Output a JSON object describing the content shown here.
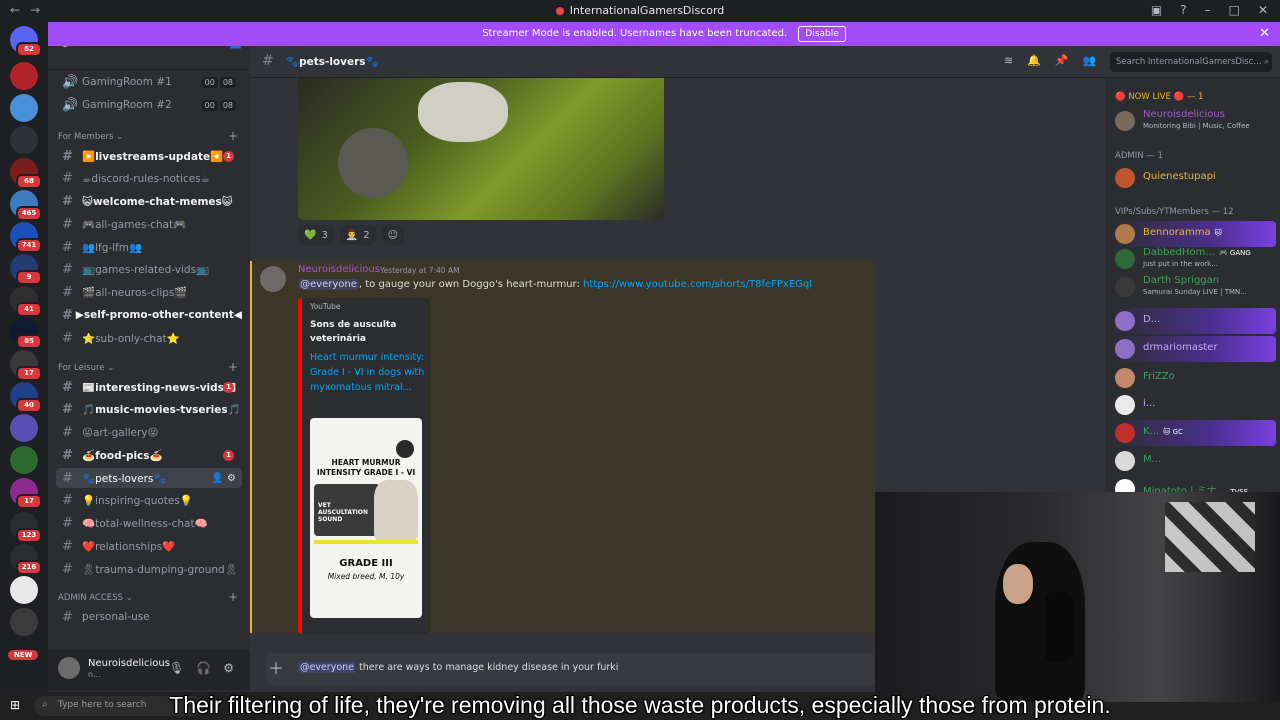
{
  "window": {
    "title": "InternationalGamersDiscord"
  },
  "streamer_banner": {
    "text": "Streamer Mode is enabled. Usernames have been truncated.",
    "button": "Disable"
  },
  "guild": {
    "name": "InternationalGamersDisc..."
  },
  "rail": {
    "badges": [
      "62",
      "68",
      "465",
      "741",
      "9",
      "41",
      "85",
      "17",
      "40",
      "17",
      "123",
      "216"
    ],
    "new_label": "NEW"
  },
  "channels": {
    "voice": [
      {
        "name": "GamingRoom #1",
        "a": "00",
        "b": "08"
      },
      {
        "name": "GamingRoom #2",
        "a": "00",
        "b": "08"
      }
    ],
    "cat_members": "For Members",
    "members_channels": [
      {
        "name": "▶️livestreams-update◀️",
        "unread": true,
        "badge": "1"
      },
      {
        "name": "☕discord-rules-notices☕",
        "unread": false
      },
      {
        "name": "😺welcome-chat-memes😺",
        "unread": true
      },
      {
        "name": "🎮all-games-chat🎮",
        "unread": false
      },
      {
        "name": "👥lfg-lfm👥",
        "unread": false
      },
      {
        "name": "📺games-related-vids📺",
        "unread": false
      },
      {
        "name": "🎬all-neuros-clips🎬",
        "unread": false
      },
      {
        "name": "▶self-promo-other-content◀",
        "unread": true
      },
      {
        "name": "⭐sub-only-chat⭐",
        "unread": false
      }
    ],
    "cat_leisure": "For Leisure",
    "leisure_channels": [
      {
        "name": "📰interesting-news-vids📰",
        "unread": true,
        "badge": "1"
      },
      {
        "name": "🎵music-movies-tvseries🎵",
        "unread": true
      },
      {
        "name": "😝art-gallery😝",
        "unread": false
      },
      {
        "name": "🍝food-pics🍝",
        "unread": true,
        "badge": "1"
      },
      {
        "name": "🐾pets-lovers🐾",
        "selected": true
      },
      {
        "name": "💡inspiring-quotes💡",
        "unread": false
      },
      {
        "name": "🧠total-wellness-chat🧠",
        "unread": false
      },
      {
        "name": "❤️relationships❤️",
        "unread": false
      },
      {
        "name": "🎗trauma-dumping-ground🎗",
        "unread": false
      }
    ],
    "cat_admin": "ADMIN ACCESS",
    "admin_channels": [
      {
        "name": "personal-use"
      }
    ]
  },
  "user": {
    "name": "Neuroisdelicious",
    "sub": "n..."
  },
  "header": {
    "channel": "🐾pets-lovers🐾",
    "search_placeholder": "Search InternationalGamersDisc..."
  },
  "chat": {
    "reactions": [
      {
        "emoji": "💚",
        "count": "3"
      },
      {
        "emoji": "👨‍⚕️",
        "count": "2"
      }
    ],
    "message": {
      "author": "Neuroisdelicious",
      "timestamp": "Yesterday at 7:40 AM",
      "mention": "@everyone",
      "text": ", to gauge your own Doggo's heart-murmur: ",
      "link": "https://www.youtube.com/shorts/T8feFPxEGqI"
    },
    "embed": {
      "provider": "YouTube",
      "author": "Sons de ausculta veterinária",
      "title": "Heart murmur intensity: Grade I - VI in dogs with myxomatous mitral...",
      "thumb_heading": "HEART MURMUR INTENSITY GRADE I - VI",
      "thumb_box": "VET AUSCULTATION SOUND",
      "thumb_grade": "GRADE III",
      "thumb_sub": "Mixed breed, M, 10y"
    },
    "composer": {
      "mention": "@everyone",
      "text": " there are ways to manage kidney disease in your furki"
    }
  },
  "members": {
    "now_live": "🔴 NOW LIVE 🔴 — 1",
    "live_member": {
      "name": "Neuroisdelicious",
      "status": "Monitoring Bibi | Music, Coffee"
    },
    "admin_cat": "ADMIN — 1",
    "admin_member": "Quienestupapi",
    "vip_cat": "VIPs/Subs/YTMembers — 12",
    "vips": [
      {
        "name": "Bennoramma",
        "tag": "🐱 ",
        "color": "#f0b232"
      },
      {
        "name": "DabbedHom...",
        "tag": "🎮 GANG",
        "status": "Just put in the work...",
        "color": "#3ba55c"
      },
      {
        "name": "Darth Spriggan",
        "status": "Samurai Sunday LIVE | TMN...",
        "color": "#3ba55c"
      },
      {
        "name": "D...",
        "color": "#c9a6ff"
      },
      {
        "name": "drmariomaster",
        "color": "#c9a6ff"
      },
      {
        "name": "FriZZo",
        "color": "#3ba55c"
      },
      {
        "name": "i...",
        "color": "#c9a6ff"
      },
      {
        "name": "K...",
        "tag": "🐱 GC",
        "color": "#3ba55c"
      },
      {
        "name": "M...",
        "color": "#3ba55c"
      },
      {
        "name": "Minatoto | ミナ...",
        "tag": "TVSF",
        "color": "#3ba55c"
      }
    ]
  },
  "taskbar": {
    "search": "Type here to search"
  },
  "caption": "Their filtering of life, they're removing all those waste products, especially those from protein."
}
